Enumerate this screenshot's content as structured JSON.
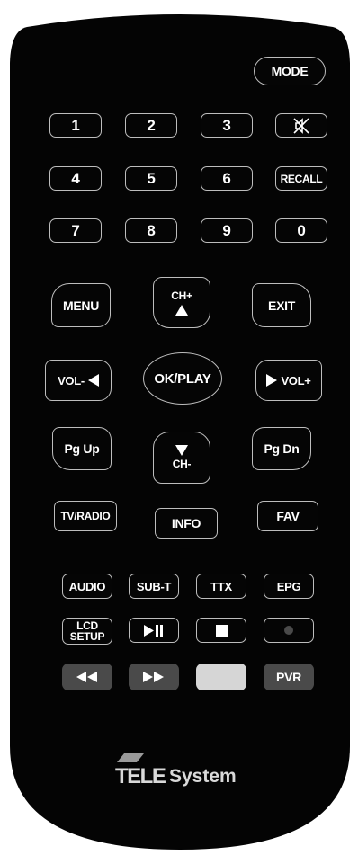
{
  "brand": {
    "tele": "TELE",
    "system": "System"
  },
  "colors": {
    "body": "#040404",
    "border": "#bdbdbd",
    "label": "#ffffff",
    "grey_button": "#4a4a4a",
    "light_button": "#d6d6d6",
    "logo": "#d9d9d9"
  },
  "buttons": {
    "mode": "MODE",
    "digits": [
      "1",
      "2",
      "3",
      "4",
      "5",
      "6",
      "7",
      "8",
      "9",
      "0"
    ],
    "mute_icon": "mute-speaker-icon",
    "recall": "RECALL",
    "menu": "MENU",
    "ch_up": "CH+",
    "exit": "EXIT",
    "vol_down": "VOL-",
    "ok_play": "OK/PLAY",
    "vol_up": "VOL+",
    "pg_up": "Pg Up",
    "ch_down": "CH-",
    "pg_dn": "Pg Dn",
    "tv_radio": "TV/RADIO",
    "info": "INFO",
    "fav": "FAV",
    "audio": "AUDIO",
    "sub_t": "SUB-T",
    "ttx": "TTX",
    "epg": "EPG",
    "lcd_setup": [
      "LCD",
      "SETUP"
    ],
    "play_pause_icon": "play-pause-icon",
    "stop_icon": "stop-icon",
    "record_icon": "record-icon",
    "rewind_icon": "rewind-icon",
    "fast_forward_icon": "fast-forward-icon",
    "pvr": "PVR"
  }
}
